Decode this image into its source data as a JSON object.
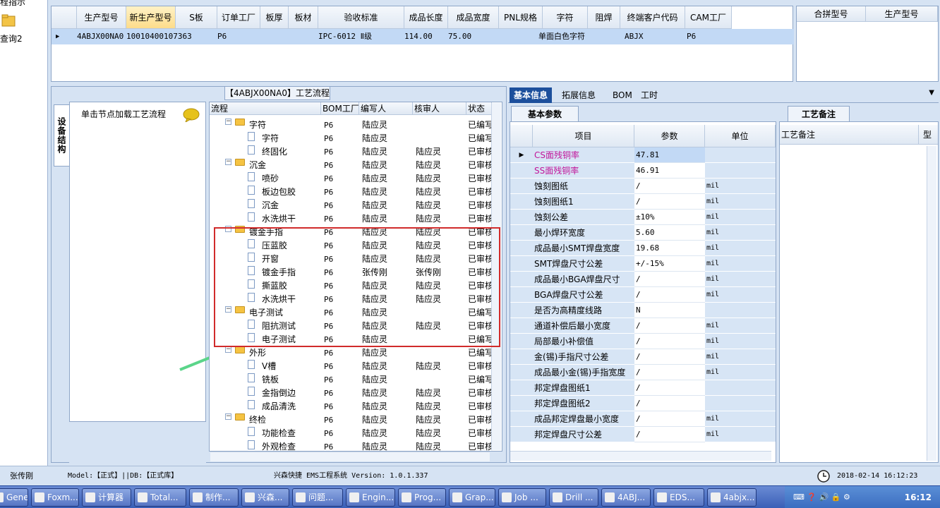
{
  "left_strip": {
    "line1": "程指示",
    "line2": "查询2"
  },
  "top_grid": {
    "headers": [
      "生产型号",
      "新生产型号",
      "S板",
      "订单工厂",
      "板厚",
      "板材",
      "验收标准",
      "成品长度",
      "成品宽度",
      "PNL规格",
      "字符",
      "阻焊",
      "终端客户代码",
      "CAM工厂"
    ],
    "row": {
      "prod_model": "4ABJX00NA0",
      "new_prod_model": "10010400107363",
      "order_factory": "P6",
      "standard": "IPC-6012 Ⅱ级",
      "length": "114.00",
      "width": "75.00",
      "char": "单面白色字符",
      "customer": "ABJX",
      "cam": "P6"
    }
  },
  "top_grid2": {
    "headers": [
      "合拼型号",
      "生产型号"
    ]
  },
  "flow_panel": {
    "title": "【4ABJX00NA0】工艺流程",
    "vertical_tab": "设备结构",
    "node_hint": "单击节点加载工艺流程",
    "columns": [
      "流程",
      "BOM工厂",
      "编写人",
      "核审人",
      "状态"
    ],
    "rows": [
      {
        "level": 1,
        "name": "字符",
        "bom": "P6",
        "writer": "陆应灵",
        "checker": "",
        "status": "已编写"
      },
      {
        "level": 2,
        "name": "字符",
        "bom": "P6",
        "writer": "陆应灵",
        "checker": "",
        "status": "已编写"
      },
      {
        "level": 2,
        "name": "终固化",
        "bom": "P6",
        "writer": "陆应灵",
        "checker": "陆应灵",
        "status": "已审核"
      },
      {
        "level": 1,
        "name": "沉金",
        "bom": "P6",
        "writer": "陆应灵",
        "checker": "陆应灵",
        "status": "已审核"
      },
      {
        "level": 2,
        "name": "喷砂",
        "bom": "P6",
        "writer": "陆应灵",
        "checker": "陆应灵",
        "status": "已审核"
      },
      {
        "level": 2,
        "name": "板边包胶",
        "bom": "P6",
        "writer": "陆应灵",
        "checker": "陆应灵",
        "status": "已审核"
      },
      {
        "level": 2,
        "name": "沉金",
        "bom": "P6",
        "writer": "陆应灵",
        "checker": "陆应灵",
        "status": "已审核"
      },
      {
        "level": 2,
        "name": "水洗烘干",
        "bom": "P6",
        "writer": "陆应灵",
        "checker": "陆应灵",
        "status": "已审核"
      },
      {
        "level": 1,
        "name": "镀金手指",
        "bom": "P6",
        "writer": "陆应灵",
        "checker": "陆应灵",
        "status": "已审核"
      },
      {
        "level": 2,
        "name": "压蓝胶",
        "bom": "P6",
        "writer": "陆应灵",
        "checker": "陆应灵",
        "status": "已审核"
      },
      {
        "level": 2,
        "name": "开窗",
        "bom": "P6",
        "writer": "陆应灵",
        "checker": "陆应灵",
        "status": "已审核"
      },
      {
        "level": 2,
        "name": "镀金手指",
        "bom": "P6",
        "writer": "张传刚",
        "checker": "张传刚",
        "status": "已审核"
      },
      {
        "level": 2,
        "name": "撕蓝胶",
        "bom": "P6",
        "writer": "陆应灵",
        "checker": "陆应灵",
        "status": "已审核"
      },
      {
        "level": 2,
        "name": "水洗烘干",
        "bom": "P6",
        "writer": "陆应灵",
        "checker": "陆应灵",
        "status": "已审核"
      },
      {
        "level": 1,
        "name": "电子测试",
        "bom": "P6",
        "writer": "陆应灵",
        "checker": "",
        "status": "已编写"
      },
      {
        "level": 2,
        "name": "阻抗测试",
        "bom": "P6",
        "writer": "陆应灵",
        "checker": "陆应灵",
        "status": "已审核"
      },
      {
        "level": 2,
        "name": "电子测试",
        "bom": "P6",
        "writer": "陆应灵",
        "checker": "",
        "status": "已编写"
      },
      {
        "level": 1,
        "name": "外形",
        "bom": "P6",
        "writer": "陆应灵",
        "checker": "",
        "status": "已编写"
      },
      {
        "level": 2,
        "name": "V槽",
        "bom": "P6",
        "writer": "陆应灵",
        "checker": "陆应灵",
        "status": "已审核"
      },
      {
        "level": 2,
        "name": "铣板",
        "bom": "P6",
        "writer": "陆应灵",
        "checker": "",
        "status": "已编写"
      },
      {
        "level": 2,
        "name": "金指倒边",
        "bom": "P6",
        "writer": "陆应灵",
        "checker": "陆应灵",
        "status": "已审核"
      },
      {
        "level": 2,
        "name": "成品清洗",
        "bom": "P6",
        "writer": "陆应灵",
        "checker": "陆应灵",
        "status": "已审核"
      },
      {
        "level": 1,
        "name": "终检",
        "bom": "P6",
        "writer": "陆应灵",
        "checker": "陆应灵",
        "status": "已审核"
      },
      {
        "level": 2,
        "name": "功能检查",
        "bom": "P6",
        "writer": "陆应灵",
        "checker": "陆应灵",
        "status": "已审核"
      },
      {
        "level": 2,
        "name": "外观检查",
        "bom": "P6",
        "writer": "陆应灵",
        "checker": "陆应灵",
        "status": "已审核"
      }
    ]
  },
  "right_tabs": [
    "基本信息",
    "拓展信息",
    "BOM",
    "工时"
  ],
  "params": {
    "subtab": "基本参数",
    "columns": [
      "项目",
      "参数",
      "单位"
    ],
    "rows": [
      {
        "item": "CS面残铜率",
        "value": "47.81",
        "unit": "",
        "magenta": true
      },
      {
        "item": "SS面残铜率",
        "value": "46.91",
        "unit": "",
        "magenta": true
      },
      {
        "item": "蚀刻图纸",
        "value": "/",
        "unit": "mil"
      },
      {
        "item": "蚀刻图纸1",
        "value": "/",
        "unit": "mil"
      },
      {
        "item": "蚀刻公差",
        "value": "±10%",
        "unit": "mil"
      },
      {
        "item": "最小焊环宽度",
        "value": "5.60",
        "unit": "mil"
      },
      {
        "item": "成品最小SMT焊盘宽度",
        "value": "19.68",
        "unit": "mil"
      },
      {
        "item": "SMT焊盘尺寸公差",
        "value": "+/-15%",
        "unit": "mil"
      },
      {
        "item": "成品最小BGA焊盘尺寸",
        "value": "/",
        "unit": "mil"
      },
      {
        "item": "BGA焊盘尺寸公差",
        "value": "/",
        "unit": "mil"
      },
      {
        "item": "是否为高精度线路",
        "value": "N",
        "unit": ""
      },
      {
        "item": "通道补偿后最小宽度",
        "value": "/",
        "unit": "mil"
      },
      {
        "item": "局部最小补偿值",
        "value": "/",
        "unit": "mil"
      },
      {
        "item": "金(锡)手指尺寸公差",
        "value": "/",
        "unit": "mil"
      },
      {
        "item": "成品最小金(锡)手指宽度",
        "value": "/",
        "unit": "mil"
      },
      {
        "item": "邦定焊盘图纸1",
        "value": "/",
        "unit": ""
      },
      {
        "item": "邦定焊盘图纸2",
        "value": "/",
        "unit": ""
      },
      {
        "item": "成品邦定焊盘最小宽度",
        "value": "/",
        "unit": "mil"
      },
      {
        "item": "邦定焊盘尺寸公差",
        "value": "/",
        "unit": "mil"
      }
    ]
  },
  "notes": {
    "tab": "工艺备注",
    "col1": "工艺备注",
    "col2": "型"
  },
  "status_bar": {
    "user": "张传刚",
    "model": "Model:【正式】||DB:【正式库】",
    "system": "兴森快捷 EMS工程系统 Version: 1.0.1.337",
    "datetime": "2018-02-14 16:12:23"
  },
  "taskbar": {
    "items": [
      "Gene...",
      "Foxm...",
      "计算器",
      "Total...",
      "制作...",
      "兴森...",
      "问题...",
      "Engin...",
      "Prog...",
      "Grap...",
      "Job ...",
      "Drill ...",
      "4ABJ...",
      "EDS...",
      "4abjx..."
    ],
    "time": "16:12"
  }
}
